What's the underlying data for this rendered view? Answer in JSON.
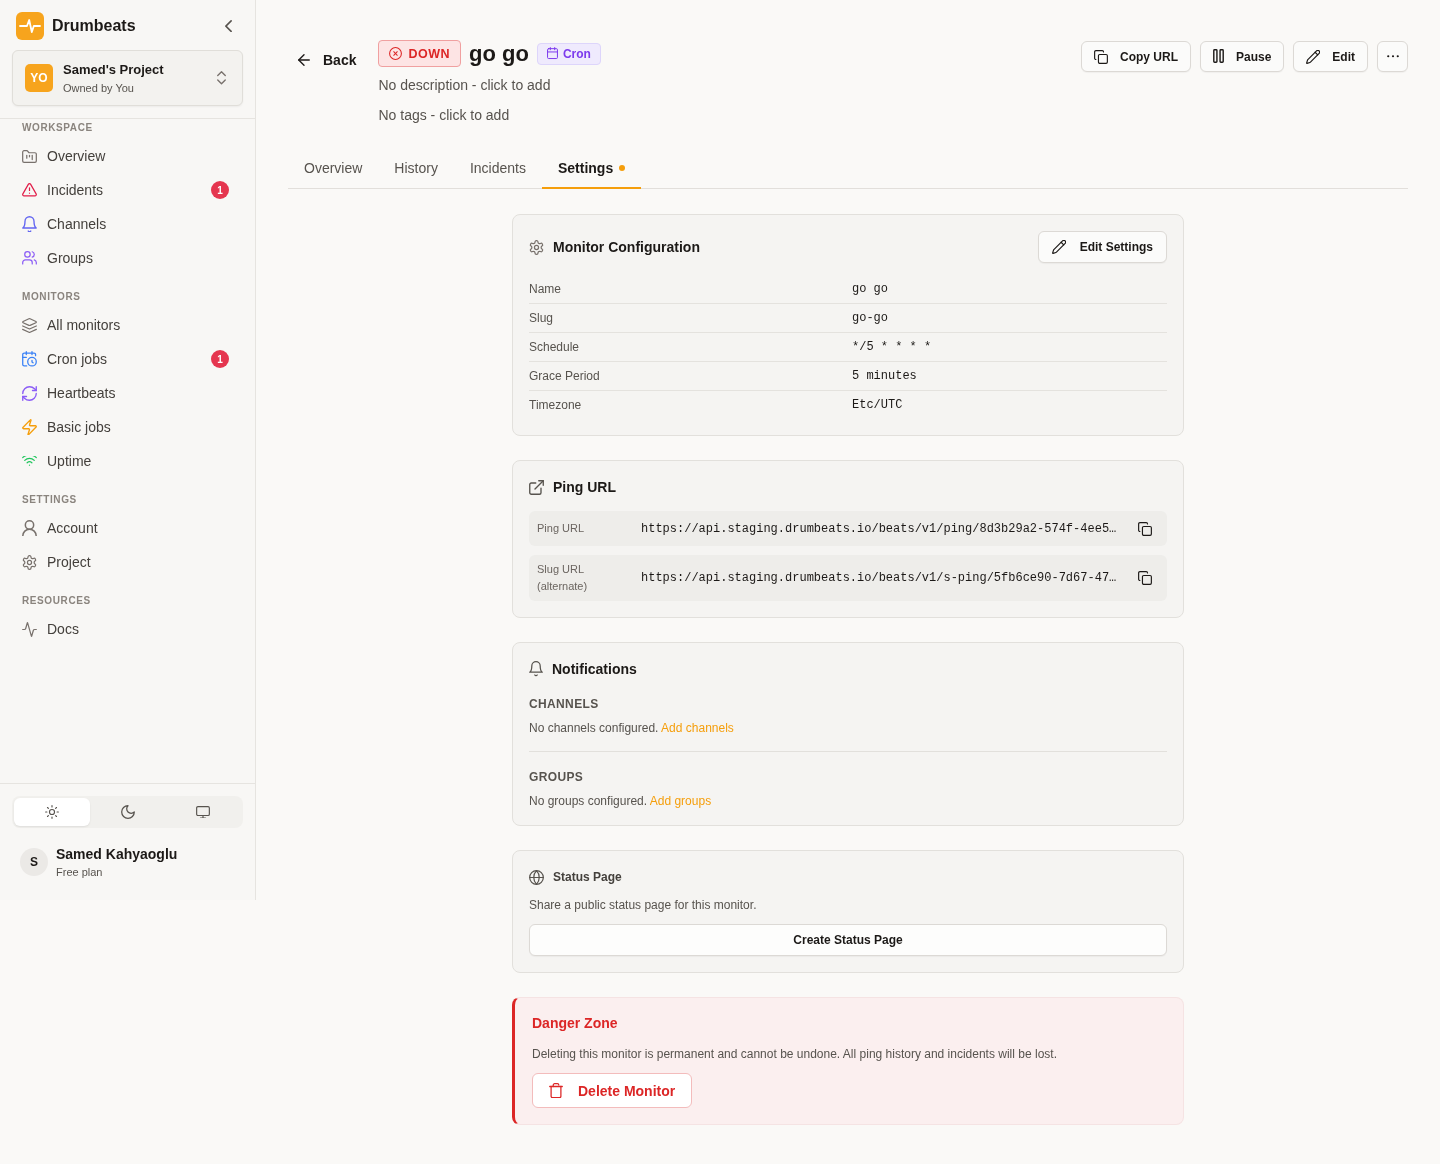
{
  "sidebar": {
    "brand": "Drumbeats",
    "project": {
      "initials": "YO",
      "name": "Samed's Project",
      "owner": "Owned by You"
    },
    "sections": [
      {
        "heading": "WORKSPACE",
        "items": [
          {
            "label": "Overview",
            "selected": false
          },
          {
            "label": "Incidents",
            "badge": "1",
            "selected": false
          },
          {
            "label": "Channels",
            "selected": false
          },
          {
            "label": "Groups",
            "selected": false
          }
        ]
      },
      {
        "heading": "MONITORS",
        "items": [
          {
            "label": "All monitors",
            "selected": false
          },
          {
            "label": "Cron jobs",
            "badge": "1",
            "selected": false
          },
          {
            "label": "Heartbeats",
            "selected": false
          },
          {
            "label": "Basic jobs",
            "selected": false
          },
          {
            "label": "Uptime",
            "selected": false
          }
        ]
      },
      {
        "heading": "SETTINGS",
        "items": [
          {
            "label": "Account",
            "selected": false
          },
          {
            "label": "Project",
            "selected": false
          }
        ]
      },
      {
        "heading": "RESOURCES",
        "items": [
          {
            "label": "Docs",
            "selected": false
          }
        ]
      }
    ],
    "theme_switcher": [
      {
        "selected": true
      },
      {
        "selected": false
      },
      {
        "selected": false
      }
    ],
    "user": {
      "initial": "S",
      "name": "Samed Kahyaoglu",
      "plan": "Free plan"
    }
  },
  "header": {
    "back": "Back",
    "status": "DOWN",
    "title": "go go",
    "type": "Cron",
    "description": "No description - click to add",
    "tags": "No tags - click to add",
    "actions": [
      "Copy URL",
      "Pause",
      "Edit"
    ]
  },
  "tabs": [
    {
      "label": "Overview",
      "selected": false,
      "dot": false
    },
    {
      "label": "History",
      "selected": false,
      "dot": false
    },
    {
      "label": "Incidents",
      "selected": false,
      "dot": false
    },
    {
      "label": "Settings",
      "selected": true,
      "dot": true
    }
  ],
  "configuration": {
    "title": "Monitor Configuration",
    "button": "Edit Settings",
    "rows": [
      {
        "label": "Name",
        "value": "go go"
      },
      {
        "label": "Slug",
        "value": "go-go"
      },
      {
        "label": "Schedule",
        "value": "*/5 * * * *"
      },
      {
        "label": "Grace Period",
        "value": "5 minutes"
      },
      {
        "label": "Timezone",
        "value": "Etc/UTC"
      }
    ]
  },
  "ping_urls": {
    "title": "Ping URL",
    "rows": [
      {
        "label": "Ping URL",
        "value": "https://api.staging.drumbeats.io/beats/v1/ping/8d3b29a2-574f-4ee5…"
      },
      {
        "label": "Slug URL (alternate)",
        "value": "https://api.staging.drumbeats.io/beats/v1/s-ping/5fb6ce90-7d67-47…"
      }
    ]
  },
  "notifications": {
    "title": "Notifications",
    "groups": [
      {
        "heading": "CHANNELS",
        "text": "No channels configured.",
        "link": "Add channels"
      },
      {
        "heading": "GROUPS",
        "text": "No groups configured.",
        "link": "Add groups"
      }
    ]
  },
  "status_page": {
    "title": "Status Page",
    "text": "Share a public status page for this monitor.",
    "button": "Create Status Page"
  },
  "danger_zone": {
    "title": "Danger Zone",
    "text": "Deleting this monitor is permanent and cannot be undone. All ping history and incidents will be lost.",
    "button": "Delete Monitor"
  }
}
